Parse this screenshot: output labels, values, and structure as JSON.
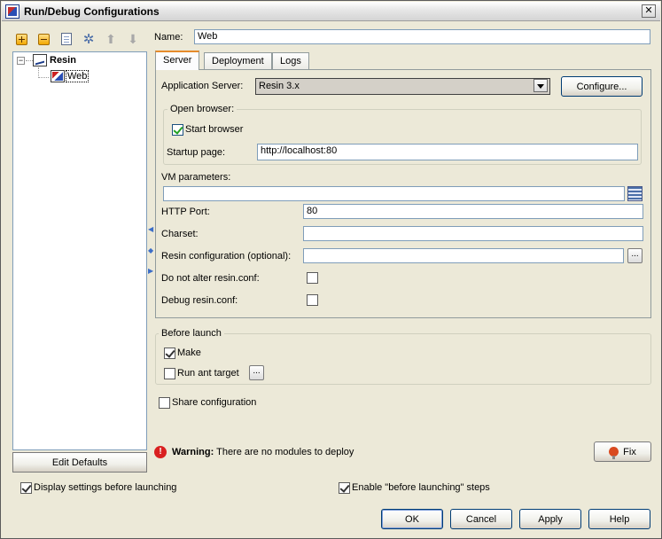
{
  "window": {
    "title": "Run/Debug Configurations",
    "close_glyph": "✕"
  },
  "toolbar": {
    "icons": [
      "add-icon",
      "remove-icon",
      "copy-icon",
      "wrench-icon",
      "move-up-icon",
      "move-down-icon"
    ]
  },
  "tree": {
    "root": {
      "label": "Resin",
      "expander": "−"
    },
    "child": {
      "label": "Web"
    }
  },
  "edit_defaults": {
    "label": "Edit Defaults"
  },
  "name": {
    "label": "Name:",
    "value": "Web"
  },
  "tabs": [
    {
      "label": "Server"
    },
    {
      "label": "Deployment"
    },
    {
      "label": "Logs"
    }
  ],
  "server": {
    "app_server_label": "Application Server:",
    "app_server_value": "Resin 3.x",
    "configure_label": "Configure...",
    "open_browser": {
      "title": "Open browser:",
      "start_browser_label": "Start browser",
      "start_browser_checked": true,
      "startup_page_label": "Startup page:",
      "startup_page_value": "http://localhost:80"
    },
    "vm_parameters_label": "VM parameters:",
    "vm_parameters_value": "",
    "http_port_label": "HTTP Port:",
    "http_port_value": "80",
    "charset_label": "Charset:",
    "charset_value": "",
    "resin_config_label": "Resin configuration (optional):",
    "resin_config_value": "",
    "ellipsis": "...",
    "do_not_alter_label": "Do not alter resin.conf:",
    "do_not_alter_checked": false,
    "debug_conf_label": "Debug resin.conf:",
    "debug_conf_checked": false
  },
  "before_launch": {
    "title": "Before launch",
    "make_label": "Make",
    "make_checked": true,
    "run_ant_label": "Run ant target",
    "run_ant_checked": false,
    "ellipsis": "..."
  },
  "share": {
    "label": "Share configuration",
    "checked": false
  },
  "warning": {
    "icon": "!",
    "bold": "Warning:",
    "text": " There are no modules to deploy"
  },
  "fix": {
    "label": "Fix"
  },
  "bottom": {
    "display_settings_label": "Display settings before launching",
    "display_settings_checked": true,
    "enable_before_label": "Enable \"before launching\" steps",
    "enable_before_checked": true
  },
  "buttons": {
    "ok": "OK",
    "cancel": "Cancel",
    "apply": "Apply",
    "help": "Help"
  }
}
